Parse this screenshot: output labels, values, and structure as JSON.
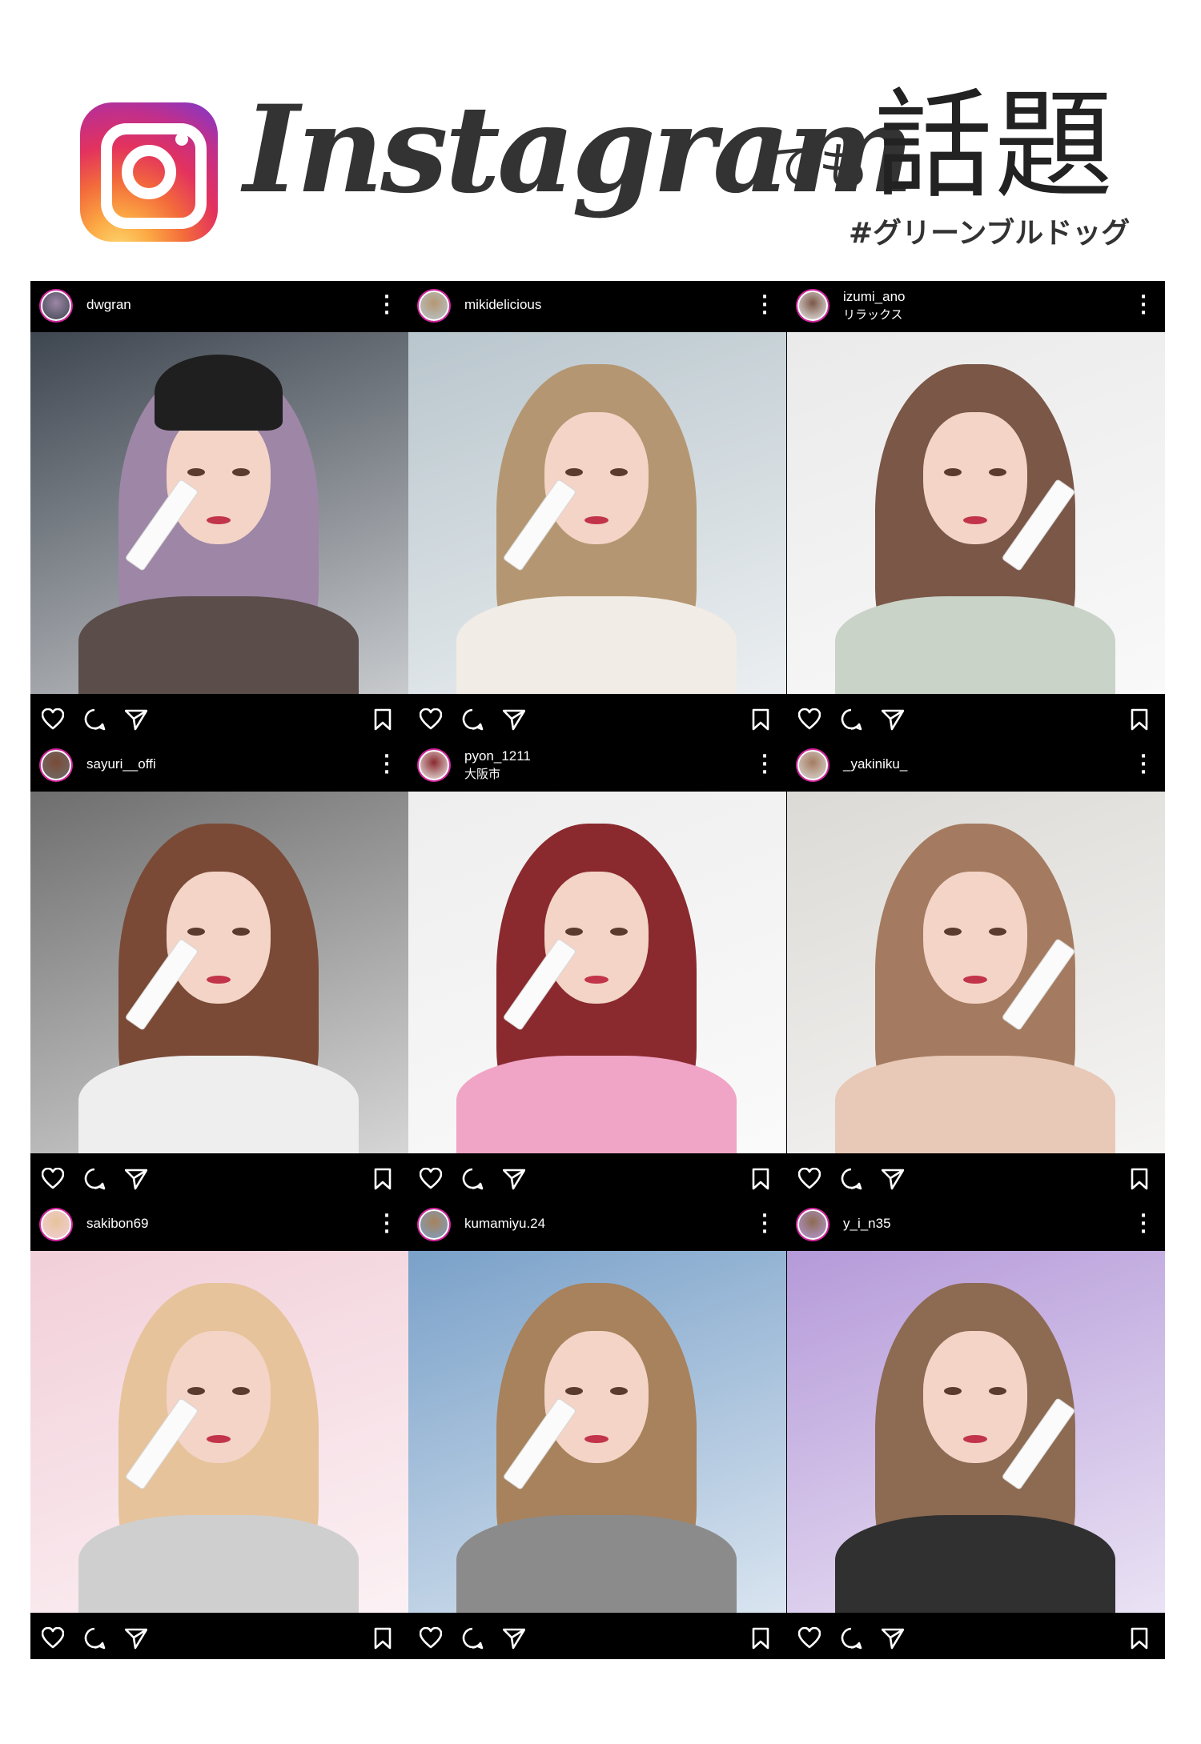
{
  "header": {
    "brand_word": "Instagram",
    "demo": "でも",
    "wadai": "話題",
    "hashtag": "#グリーンブルドッグ",
    "logo_icon": "instagram-logo-icon"
  },
  "posts": [
    {
      "username": "dwgran",
      "location": "",
      "bg": "#3e4650",
      "hair": "#9d86a6",
      "shirt": "#5a4d4a",
      "hat": "#1f1f1f"
    },
    {
      "username": "mikidelicious",
      "location": "",
      "bg": "#b9c6cd",
      "hair": "#b49772",
      "shirt": "#f1ece6"
    },
    {
      "username": "izumi_ano",
      "location": "リラックス",
      "bg": "#eaeaea",
      "hair": "#7b5748",
      "shirt": "#c9d3c8"
    },
    {
      "username": "sayuri__offi",
      "location": "",
      "bg": "#6e6e6e",
      "hair": "#7a4a36",
      "shirt": "#eeeeee"
    },
    {
      "username": "pyon_1211",
      "location": "大阪市",
      "bg": "#eeeeee",
      "hair": "#8a2a2e",
      "shirt": "#f0a4c6"
    },
    {
      "username": "_yakiniku_",
      "location": "",
      "bg": "#dcdad6",
      "hair": "#a47b60",
      "shirt": "#e8c8b6"
    },
    {
      "username": "sakibon69",
      "location": "",
      "bg": "#f2cfd9",
      "hair": "#e6c39b",
      "shirt": "#cfcfcf"
    },
    {
      "username": "kumamiyu.24",
      "location": "",
      "bg": "#7aa1c9",
      "hair": "#a7825c",
      "shirt": "#8b8b8b"
    },
    {
      "username": "y_i_n35",
      "location": "",
      "bg": "#b59ad9",
      "hair": "#8d6a52",
      "shirt": "#303030"
    }
  ],
  "action_icons": [
    "heart-icon",
    "comment-icon",
    "share-icon",
    "bookmark-icon"
  ],
  "menu_icon": "more-dots-icon"
}
